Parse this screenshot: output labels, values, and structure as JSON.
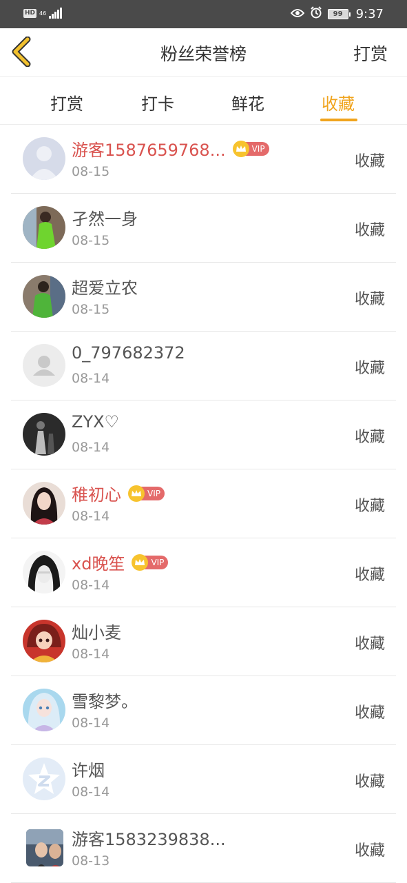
{
  "status_bar": {
    "hd": "HD",
    "network": "46",
    "battery": "99",
    "time": "9:37"
  },
  "header": {
    "title": "粉丝荣誉榜",
    "action": "打赏"
  },
  "tabs": [
    {
      "label": "打赏",
      "active": false
    },
    {
      "label": "打卡",
      "active": false
    },
    {
      "label": "鲜花",
      "active": false
    },
    {
      "label": "收藏",
      "active": true
    }
  ],
  "vip_label": "VIP",
  "list": [
    {
      "name": "游客1587659768...",
      "date": "08-15",
      "vip": true,
      "action": "收藏",
      "avatar": "default-avatar"
    },
    {
      "name": "孑然一身",
      "date": "08-15",
      "vip": false,
      "action": "收藏",
      "avatar": "photo-avatar-green"
    },
    {
      "name": "超爱立农",
      "date": "08-15",
      "vip": false,
      "action": "收藏",
      "avatar": "photo-avatar-green2"
    },
    {
      "name": "0_797682372",
      "date": "08-14",
      "vip": false,
      "action": "收藏",
      "avatar": "gray-person-avatar"
    },
    {
      "name": "ZYX♡",
      "date": "08-14",
      "vip": false,
      "action": "收藏",
      "avatar": "photo-avatar-dark"
    },
    {
      "name": "稚初心",
      "date": "08-14",
      "vip": true,
      "action": "收藏",
      "avatar": "photo-avatar-girl"
    },
    {
      "name": "xd晚笙",
      "date": "08-14",
      "vip": true,
      "action": "收藏",
      "avatar": "photo-avatar-white"
    },
    {
      "name": "灿小麦",
      "date": "08-14",
      "vip": false,
      "action": "收藏",
      "avatar": "anime-avatar-red"
    },
    {
      "name": "雪黎梦。",
      "date": "08-14",
      "vip": false,
      "action": "收藏",
      "avatar": "anime-avatar-blue"
    },
    {
      "name": "许烟",
      "date": "08-14",
      "vip": false,
      "action": "收藏",
      "avatar": "qq-star-avatar"
    },
    {
      "name": "游客1583239838...",
      "date": "08-13",
      "vip": false,
      "action": "收藏",
      "avatar": "photo-avatar-couple"
    }
  ],
  "colors": {
    "accent": "#f0a41e",
    "vip_name": "#d9534f",
    "status_bar": "#4a4a4a"
  }
}
